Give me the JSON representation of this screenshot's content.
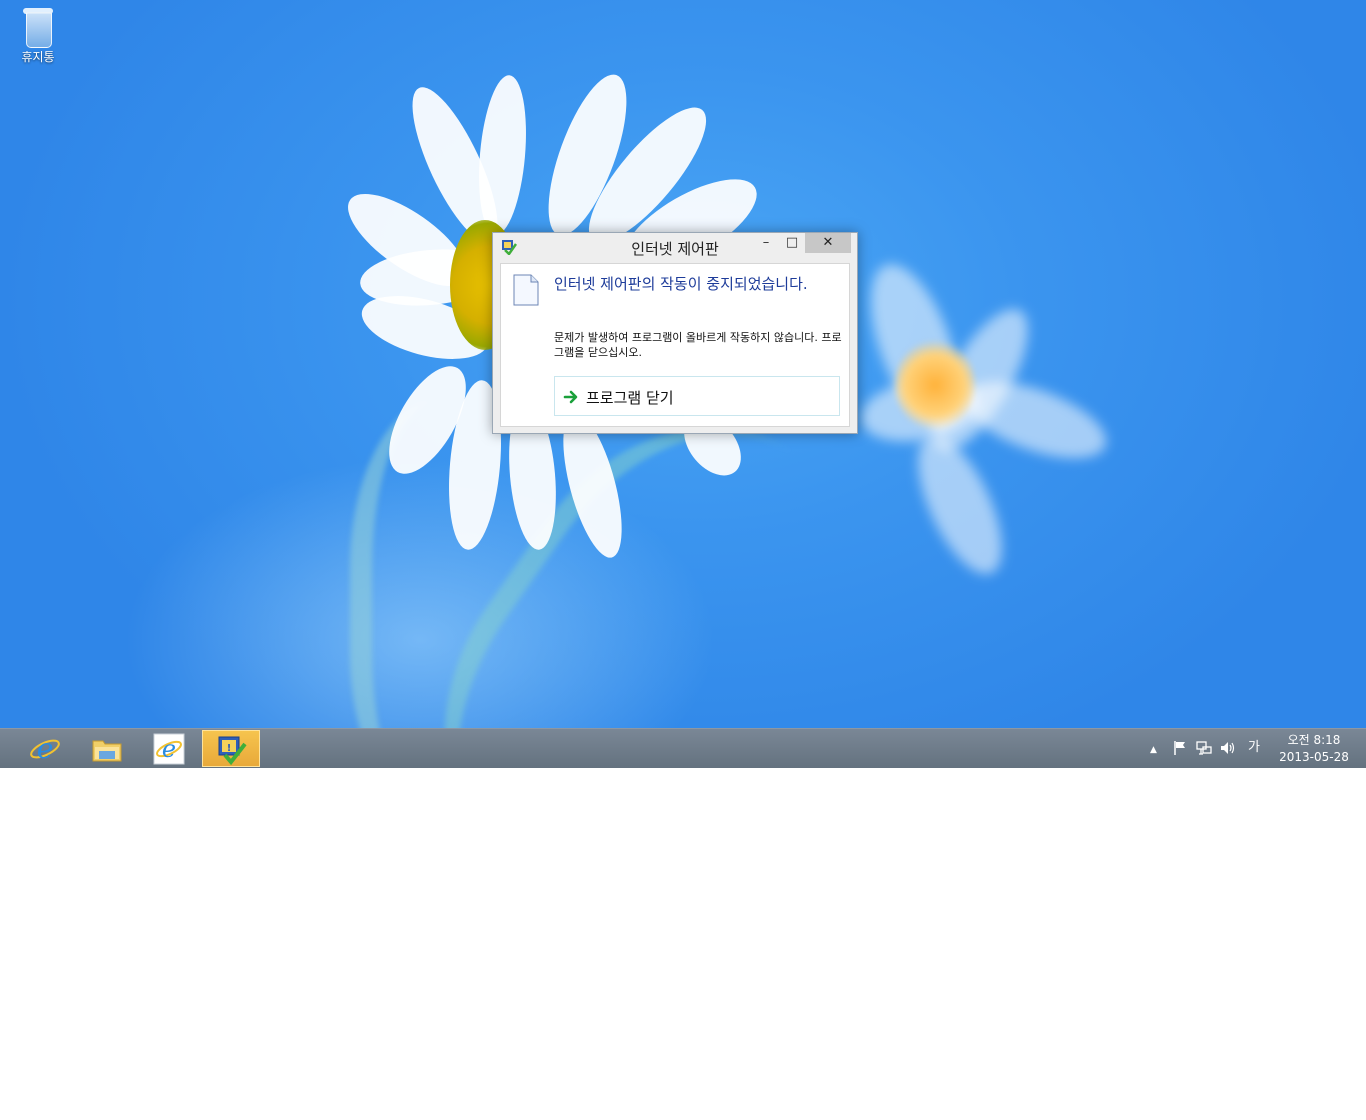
{
  "desktop": {
    "icons": [
      {
        "label": "휴지통"
      }
    ]
  },
  "dialog": {
    "title": "인터넷 제어판",
    "minimize": "–",
    "maximize": "□",
    "close": "✕",
    "main_instruction": "인터넷 제어판의 작동이 중지되었습니다.",
    "detail": "문제가 발생하여 프로그램이 올바르게 작동하지 않습니다. 프로그램을 닫으십시오.",
    "close_program_label": "프로그램 닫기"
  },
  "taskbar": {
    "buttons": [
      {
        "icon": "internet-explorer-icon"
      },
      {
        "icon": "file-explorer-icon"
      },
      {
        "icon": "internet-explorer-icon"
      },
      {
        "icon": "control-panel-icon",
        "active": true
      }
    ],
    "tray": {
      "up_arrow": "▲",
      "ime": "가",
      "time": "오전 8:18",
      "date": "2013-05-28"
    }
  },
  "colors": {
    "desktop_blue": "#3b95ef",
    "taskbar": "#6b7885",
    "instruction_text": "#1e3c9a",
    "active_task": "#f0b644"
  }
}
